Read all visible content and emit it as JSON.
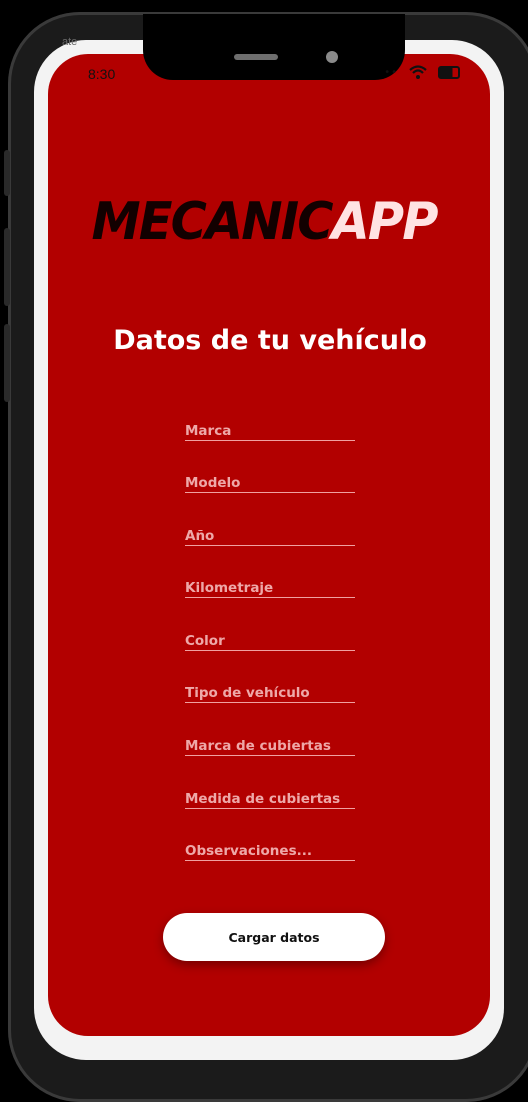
{
  "status_bar": {
    "time": "8:30",
    "ghost_label": "ate",
    "icons": [
      "signal-icon",
      "wifi-icon",
      "battery-icon"
    ]
  },
  "logo": {
    "part1": "MECANIC",
    "part2": "APP"
  },
  "title": "Datos de tu vehículo",
  "form": {
    "fields": [
      {
        "placeholder": "Marca",
        "value": ""
      },
      {
        "placeholder": "Modelo",
        "value": ""
      },
      {
        "placeholder": "Año",
        "value": ""
      },
      {
        "placeholder": "Kilometraje",
        "value": ""
      },
      {
        "placeholder": "Color",
        "value": ""
      },
      {
        "placeholder": "Tipo de vehículo",
        "value": ""
      },
      {
        "placeholder": "Marca de cubiertas",
        "value": ""
      },
      {
        "placeholder": "Medida de cubiertas",
        "value": ""
      },
      {
        "placeholder": "Observaciones...",
        "value": ""
      }
    ],
    "submit_label": "Cargar datos"
  },
  "colors": {
    "background": "#b20000",
    "logo_dark": "#120000",
    "logo_light": "#ffe3e3",
    "button_bg": "#ffffff"
  }
}
